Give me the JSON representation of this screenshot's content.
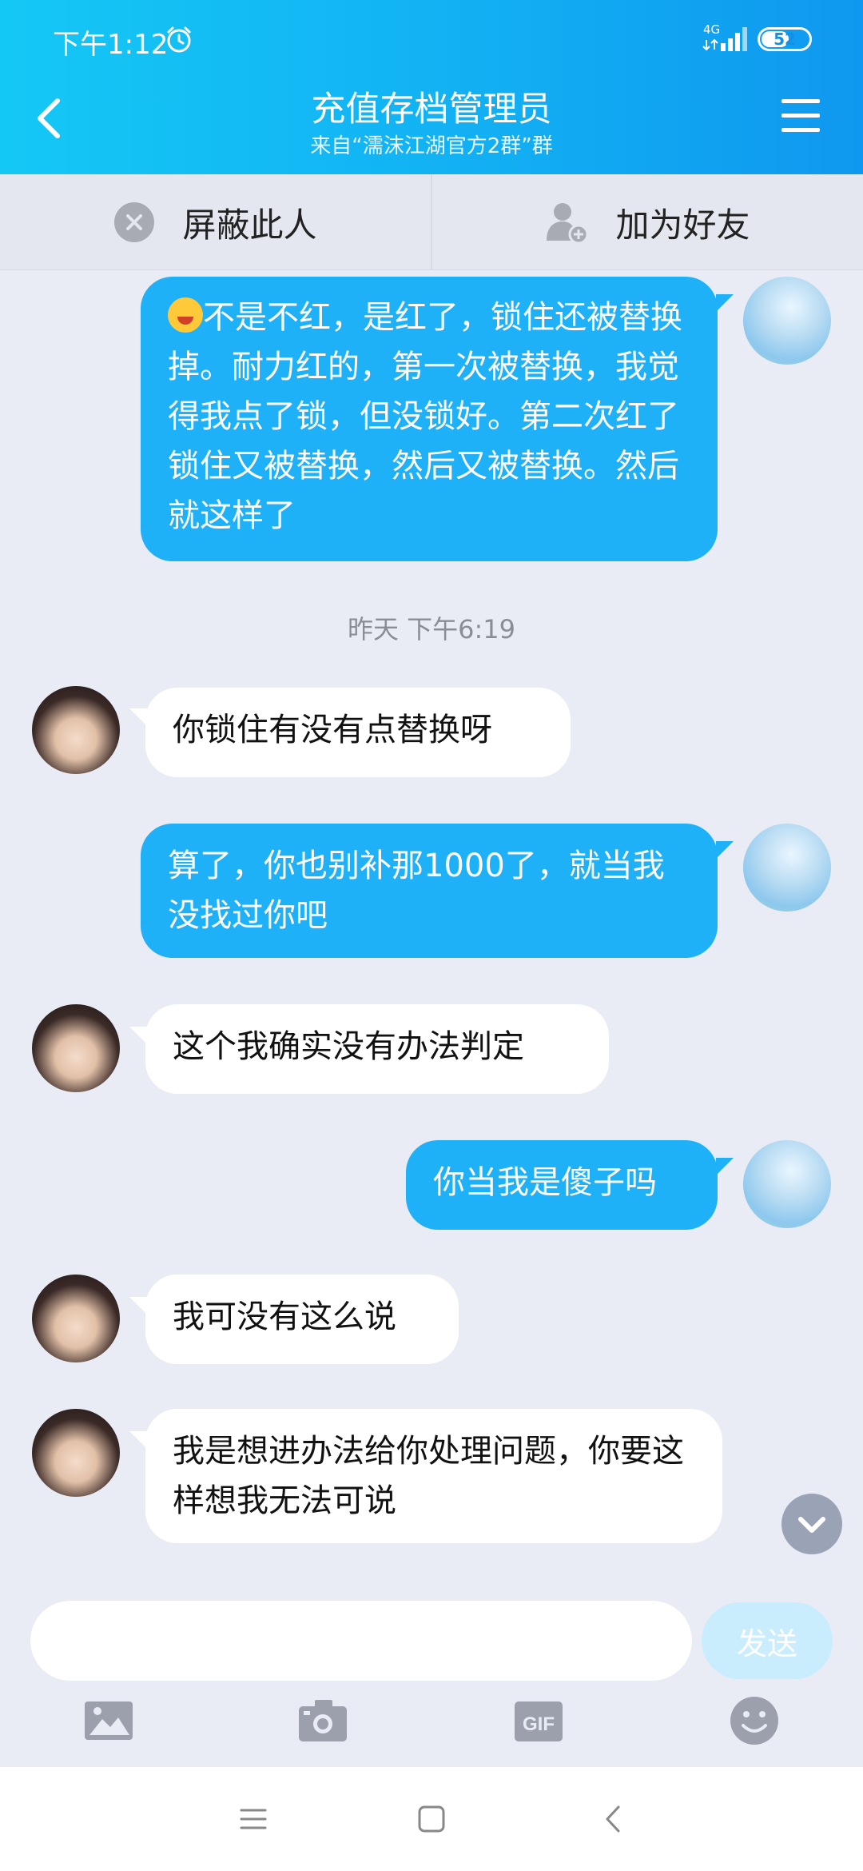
{
  "status": {
    "time": "下午1:12",
    "network": "4G",
    "battery": "52"
  },
  "header": {
    "title": "充值存档管理员",
    "subtitle": "来自“濡沫江湖官方2群”群"
  },
  "actions": {
    "block": "屏蔽此人",
    "add_friend": "加为好友"
  },
  "messages": {
    "m1": "不是不红，是红了，锁住还被替换掉。耐力红的，第一次被替换，我觉得我点了锁，但没锁好。第二次红了锁住又被替换，然后又被替换。然后就这样了",
    "timestamp": "昨天 下午6:19",
    "m2": "你锁住有没有点替换呀",
    "m3": "算了，你也别补那1000了，就当我没找过你吧",
    "m4": "这个我确实没有办法判定",
    "m5": "你当我是傻子吗",
    "m6": "我可没有这么说",
    "m7": "我是想进办法给你处理问题，你要这样想我无法可说"
  },
  "input": {
    "placeholder": "",
    "send_label": "发送"
  },
  "colors": {
    "header": "#12b0f3",
    "my_bubble": "#1fb1f7",
    "their_bubble": "#ffffff",
    "chat_bg": "#e9ecf5"
  }
}
